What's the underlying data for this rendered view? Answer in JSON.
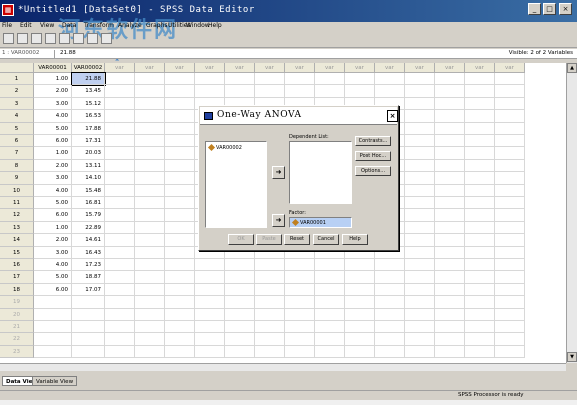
{
  "window": {
    "title": "*Untitled1 [DataSet0] - SPSS Data Editor",
    "controls": [
      "_",
      "□",
      "×"
    ]
  },
  "watermark": {
    "text": "河东软件网",
    "url": "www.pc0359.cn"
  },
  "menu": [
    "File",
    "Edit",
    "View",
    "Data",
    "Transform",
    "Analyze",
    "Graphs",
    "Utilities",
    "Add-ons",
    "Window",
    "Help"
  ],
  "cellbar": {
    "ref": "1 : VAR00002",
    "value": "21.88",
    "visible": "Visible: 2 of 2 Variables"
  },
  "grid": {
    "columns": [
      "VAR00001",
      "VAR00002",
      "var",
      "var",
      "var",
      "var",
      "var",
      "var",
      "var",
      "var",
      "var",
      "var",
      "var",
      "var",
      "var",
      "var"
    ],
    "rows": [
      [
        "1.00",
        "21.88"
      ],
      [
        "2.00",
        "13.45"
      ],
      [
        "3.00",
        "15.12"
      ],
      [
        "4.00",
        "16.53"
      ],
      [
        "5.00",
        "17.88"
      ],
      [
        "6.00",
        "17.31"
      ],
      [
        "1.00",
        "20.03"
      ],
      [
        "2.00",
        "13.11"
      ],
      [
        "3.00",
        "14.10"
      ],
      [
        "4.00",
        "15.48"
      ],
      [
        "5.00",
        "16.81"
      ],
      [
        "6.00",
        "15.79"
      ],
      [
        "1.00",
        "22.89"
      ],
      [
        "2.00",
        "14.61"
      ],
      [
        "3.00",
        "16.43"
      ],
      [
        "4.00",
        "17.23"
      ],
      [
        "5.00",
        "18.87"
      ],
      [
        "6.00",
        "17.07"
      ]
    ],
    "empty_rows": [
      "19",
      "20",
      "21",
      "22",
      "23"
    ]
  },
  "tabs": [
    "Data View",
    "Variable View"
  ],
  "status": "SPSS Processor is ready",
  "dialog": {
    "title": "One-Way ANOVA",
    "close": "×",
    "source_item": "VAR00002",
    "dependent_label": "Dependent List:",
    "factor_label": "Factor:",
    "factor_value": "VAR00001",
    "side_buttons": [
      "Contrasts...",
      "Post Hoc...",
      "Options..."
    ],
    "bottom_buttons": [
      "OK",
      "Paste",
      "Reset",
      "Cancel",
      "Help"
    ]
  }
}
